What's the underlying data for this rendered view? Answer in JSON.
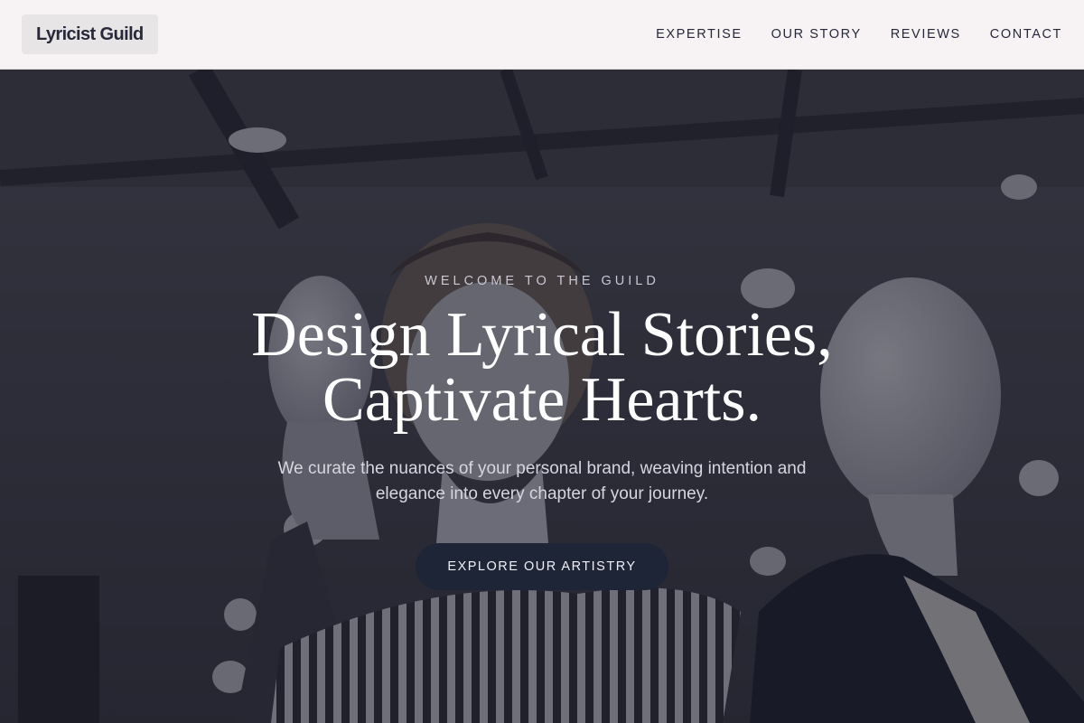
{
  "brand": {
    "name": "Lyricist Guild"
  },
  "nav": {
    "items": [
      {
        "label": "EXPERTISE"
      },
      {
        "label": "OUR STORY"
      },
      {
        "label": "REVIEWS"
      },
      {
        "label": "CONTACT"
      }
    ]
  },
  "hero": {
    "eyebrow": "WELCOME TO THE GUILD",
    "headline": "Design Lyrical Stories, Captivate Hearts.",
    "subtitle": "We curate the nuances of your personal brand, weaving intention and elegance into every chapter of your journey.",
    "cta_label": "EXPLORE OUR ARTISTRY",
    "background_image": "boutique-mannequins-photo"
  },
  "colors": {
    "header_bg": "#f7f3f4",
    "text_dark": "#27293a",
    "cta_bg": "#1e2536",
    "overlay": "#141622"
  }
}
